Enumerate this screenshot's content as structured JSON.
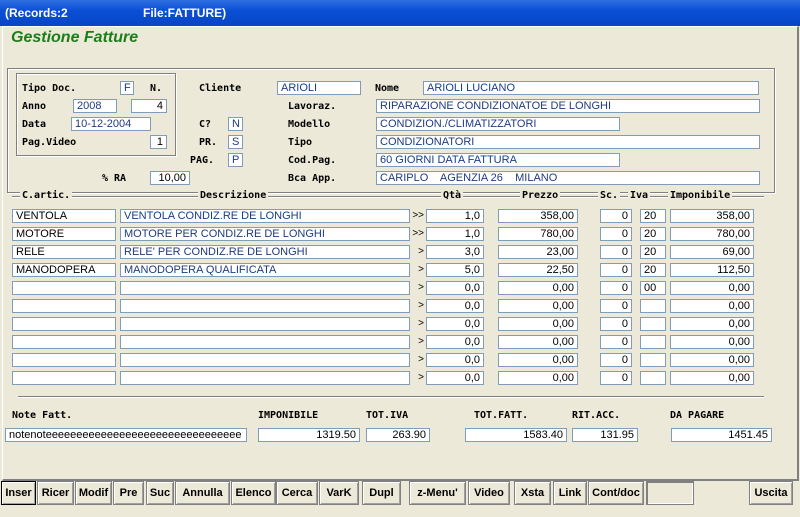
{
  "titlebar": {
    "records": "(Records:2",
    "file": "File:FATTURE)"
  },
  "app_title": "Gestione Fatture",
  "header": {
    "tipo_doc_label": "Tipo Doc.",
    "tipo_doc": "F",
    "n_label": "N.",
    "n": "4",
    "anno_label": "Anno",
    "anno": "2008",
    "data_label": "Data",
    "data": "10-12-2004",
    "pag_video_label": "Pag.Video",
    "pag_video": "1",
    "cliente_label": "Cliente",
    "cliente": "ARIOLI",
    "nome_label": "Nome",
    "nome": "ARIOLI LUCIANO",
    "lavoraz_label": "Lavoraz.",
    "lavoraz": "RIPARAZIONE CONDIZIONATOE DE LONGHI",
    "c_label": "C?",
    "c": "N",
    "modello_label": "Modello",
    "modello": "CONDIZION./CLIMATIZZATORI",
    "pr_label": "PR.",
    "pr": "S",
    "tipo_label": "Tipo",
    "tipo": "CONDIZIONATORI",
    "pag_label": "PAG.",
    "pag": "P",
    "codpag_label": "Cod.Pag.",
    "codpag": "60 GIORNI DATA FATTURA",
    "ra_label": "% RA",
    "ra": "10,00",
    "bca_label": "Bca App.",
    "bca": "CARIPLO    AGENZIA 26    MILANO"
  },
  "columns": {
    "cartic": "C.artic.",
    "descr": "Descrizione",
    "qta": "Qtà",
    "prezzo": "Prezzo",
    "sc": "Sc.",
    "iva": "Iva",
    "imponibile": "Imponibile"
  },
  "rows": [
    {
      "code": "VENTOLA",
      "desc": "VENTOLA CONDIZ.RE DE LONGHI",
      "arrow": ">>",
      "qta": "1,0",
      "prezzo": "358,00",
      "sc": "0",
      "iva": "20",
      "imp": "358,00"
    },
    {
      "code": "MOTORE",
      "desc": "MOTORE PER CONDIZ.RE DE LONGHI",
      "arrow": ">>",
      "qta": "1,0",
      "prezzo": "780,00",
      "sc": "0",
      "iva": "20",
      "imp": "780,00"
    },
    {
      "code": "RELE",
      "desc": "RELE' PER CONDIZ.RE DE LONGHI",
      "arrow": ">",
      "qta": "3,0",
      "prezzo": "23,00",
      "sc": "0",
      "iva": "20",
      "imp": "69,00"
    },
    {
      "code": "MANODOPERA",
      "desc": "MANODOPERA QUALIFICATA",
      "arrow": ">",
      "qta": "5,0",
      "prezzo": "22,50",
      "sc": "0",
      "iva": "20",
      "imp": "112,50"
    },
    {
      "code": "",
      "desc": "",
      "arrow": ">",
      "qta": "0,0",
      "prezzo": "0,00",
      "sc": "0",
      "iva": "00",
      "imp": "0,00"
    },
    {
      "code": "",
      "desc": "",
      "arrow": ">",
      "qta": "0,0",
      "prezzo": "0,00",
      "sc": "0",
      "iva": "",
      "imp": "0,00"
    },
    {
      "code": "",
      "desc": "",
      "arrow": ">",
      "qta": "0,0",
      "prezzo": "0,00",
      "sc": "0",
      "iva": "",
      "imp": "0,00"
    },
    {
      "code": "",
      "desc": "",
      "arrow": ">",
      "qta": "0,0",
      "prezzo": "0,00",
      "sc": "0",
      "iva": "",
      "imp": "0,00"
    },
    {
      "code": "",
      "desc": "",
      "arrow": ">",
      "qta": "0,0",
      "prezzo": "0,00",
      "sc": "0",
      "iva": "",
      "imp": "0,00"
    },
    {
      "code": "",
      "desc": "",
      "arrow": ">",
      "qta": "0,0",
      "prezzo": "0,00",
      "sc": "0",
      "iva": "",
      "imp": "0,00"
    }
  ],
  "footer": {
    "note_label": "Note Fatt.",
    "note": "notenoteeeeeeeeeeeeeeeeeeeeeeeeeeeeeeee",
    "imponibile_label": "IMPONIBILE",
    "imponibile": "1319.50",
    "totiva_label": "TOT.IVA",
    "totiva": "263.90",
    "totfatt_label": "TOT.FATT.",
    "totfatt": "1583.40",
    "ritacc_label": "RIT.ACC.",
    "ritacc": "131.95",
    "dapagare_label": "DA PAGARE",
    "dapagare": "1451.45"
  },
  "toolbar": [
    "Inser",
    "Ricer",
    "Modif",
    "Pre",
    "Suc",
    "Annulla",
    "Elenco",
    "Cerca",
    "VarK",
    "Dupl",
    "z-Menu'",
    "Video",
    "Xsta",
    "Link",
    "Cont/doc",
    "",
    "Uscita"
  ]
}
